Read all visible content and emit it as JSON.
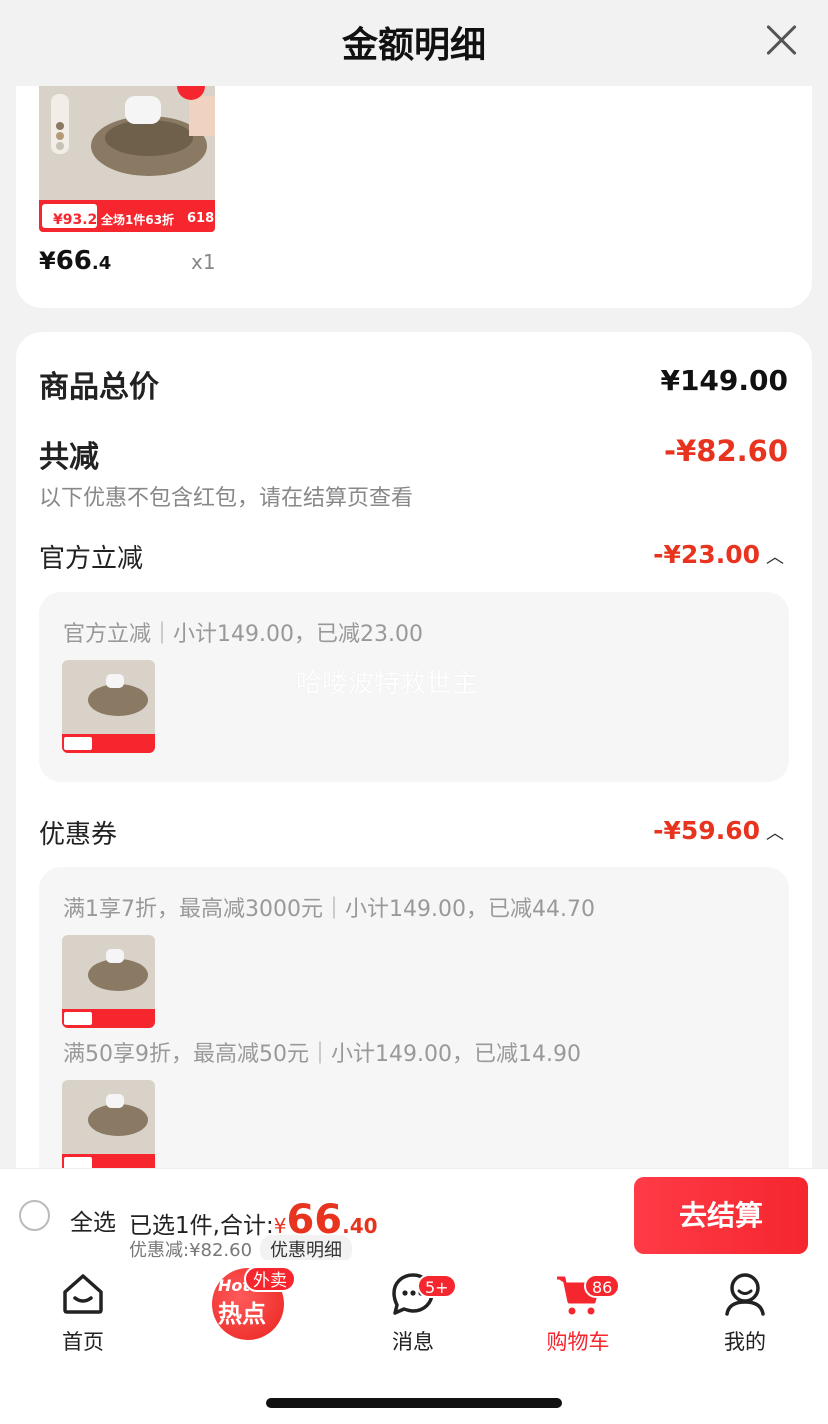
{
  "header": {
    "title": "金额明细"
  },
  "product": {
    "price_currency": "¥",
    "price_int": "66",
    "price_dec": ".4",
    "quantity": "x1",
    "img_tags": {
      "price_tag": "¥93.2",
      "promo": "全场1件63折",
      "event": "618"
    }
  },
  "summary": {
    "total_label": "商品总价",
    "total_value": "¥149.00",
    "reduce_label": "共减",
    "reduce_value": "-¥82.60",
    "reduce_note": "以下优惠不包含红包，请在结算页查看"
  },
  "sections": [
    {
      "title": "官方立减",
      "value": "-¥23.00",
      "lines": [
        "官方立减｜小计149.00，已减23.00"
      ]
    },
    {
      "title": "优惠券",
      "value": "-¥59.60",
      "lines": [
        "满1享7折，最高减3000元｜小计149.00，已减44.70",
        "满50享9折，最高减50元｜小计149.00，已减14.90"
      ]
    }
  ],
  "watermark": "哈喽波特救世主",
  "checkout": {
    "select_all": "全选",
    "selected_prefix": "已选1件,合计:",
    "currency": "¥",
    "amount_int": "66",
    "amount_dec": ".40",
    "discount_text": "优惠减:¥82.60",
    "discount_detail": "优惠明细",
    "checkout_label": "去结算"
  },
  "tabbar": {
    "home": "首页",
    "hot_top": "Hot",
    "hot_main": "热点",
    "waimai": "外卖",
    "messages": "消息",
    "messages_badge": "5+",
    "cart": "购物车",
    "cart_badge": "86",
    "me": "我的"
  },
  "colors": {
    "accent": "#f5262e",
    "discount_red": "#e8341f"
  }
}
